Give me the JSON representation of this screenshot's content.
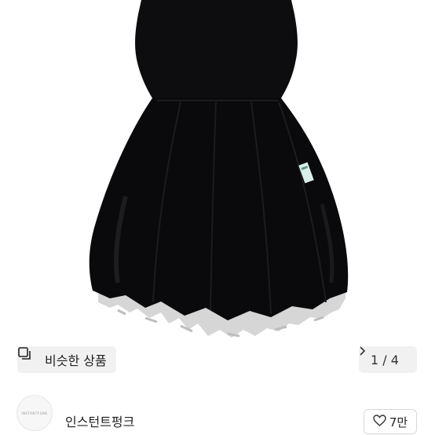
{
  "product_image": {
    "description_icon": "black-velvet-dress",
    "colors": {
      "dress": "#0d0d0f",
      "lace": "#d6d6d6",
      "background": "#ffffff"
    }
  },
  "similar_products": {
    "label": "비슷한 상품",
    "icon": "similar-items-icon"
  },
  "pager": {
    "current": "1",
    "separator": "/",
    "total": "4",
    "text": "1 / 4",
    "icon": "chevron-right-icon"
  },
  "seller": {
    "name": "인스턴트펑크",
    "avatar_text": "INSTANTFUNK"
  },
  "like": {
    "count": "7만",
    "icon": "heart-outline-icon"
  }
}
